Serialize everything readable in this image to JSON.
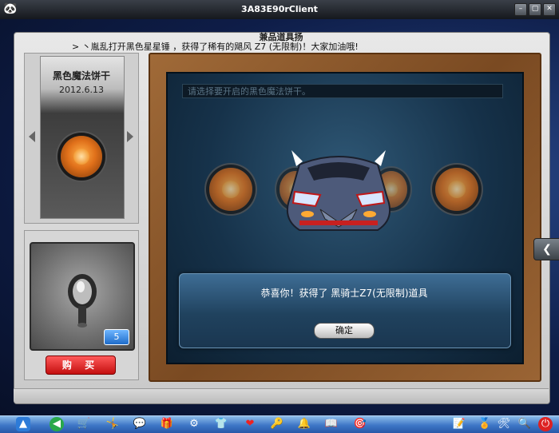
{
  "window": {
    "title": "3A83E90rClient"
  },
  "dialog": {
    "title": "兼品道具扬"
  },
  "ticker": {
    "text": "> 丶胤乱打开黑色星星锤 ，获得了稀有的飓风 Z7 (无限制)！大家加油哦!"
  },
  "card": {
    "name": "黑色魔法饼干",
    "date": "2012.6.13"
  },
  "item": {
    "count": "5"
  },
  "buy_button": {
    "label": "购 买"
  },
  "main": {
    "select_hint": "请选择要开启的黑色魔法饼干。"
  },
  "result": {
    "message": "恭喜你！获得了 黑骑士Z7(无限制)道具",
    "ok_label": "确定"
  },
  "colors": {
    "frame_wood": "#7a4a22",
    "result_panel": "#2b5678",
    "buy_red": "#e02020",
    "count_blue": "#1e6cc9"
  },
  "taskbar_icons": [
    "start-icon",
    "back-icon",
    "cart-icon",
    "person-icon",
    "chat-icon",
    "gift-icon",
    "gear-icon",
    "shirt-icon",
    "heart-icon",
    "key-icon",
    "bell-icon",
    "book-icon",
    "target-icon",
    "note-icon",
    "badge-icon",
    "tools-icon",
    "search-icon",
    "power-icon"
  ]
}
